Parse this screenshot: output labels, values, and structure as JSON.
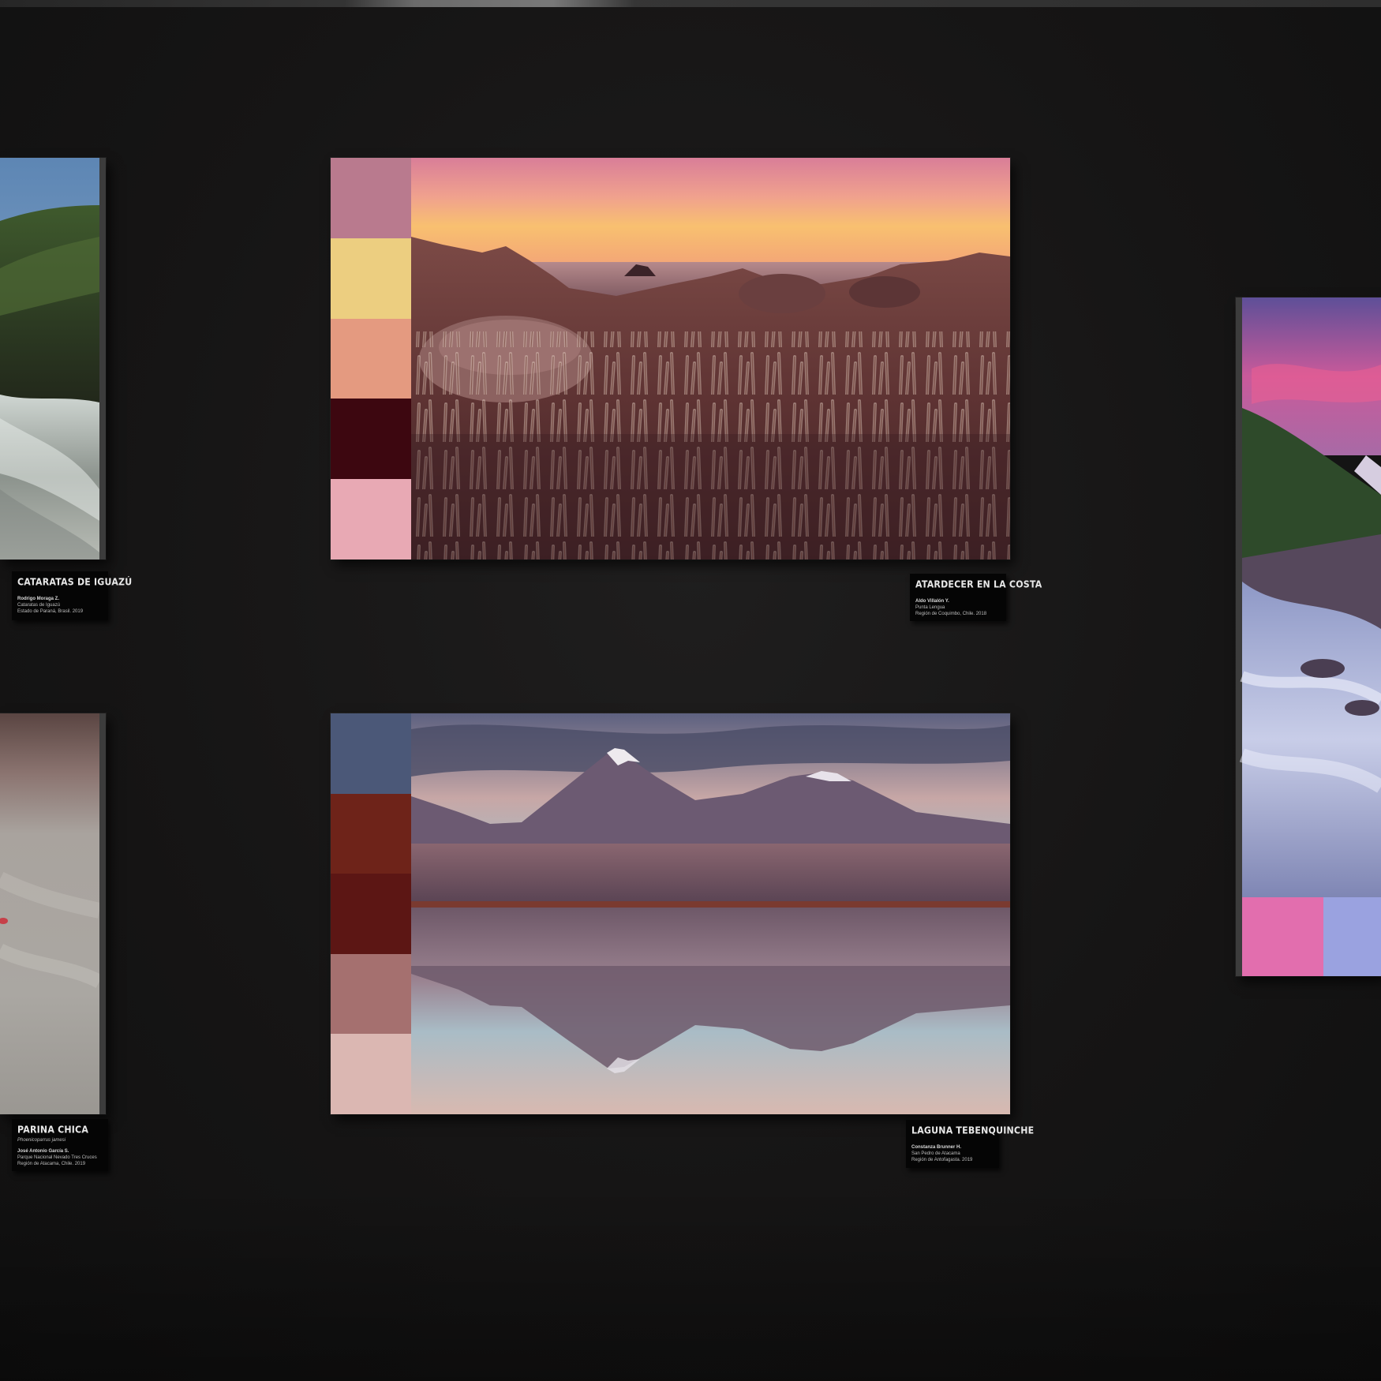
{
  "gallery": {
    "artworks": [
      {
        "id": "cataratas",
        "title": "CATARATAS DE IGUAZÚ",
        "lines": [
          "Rodrigo Moraga Z.",
          "Cataratas de Iguazú",
          "Estado de Paraná, Brasil. 2019"
        ]
      },
      {
        "id": "atardecer",
        "title": "ATARDECER EN LA COSTA",
        "lines": [
          "Aldo Villalón Y.",
          "Punta Lengua",
          "Región de Coquimbo, Chile. 2018"
        ],
        "palette": [
          "#b97a8e",
          "#ecce80",
          "#e49a80",
          "#3d0710",
          "#e8a9b4"
        ]
      },
      {
        "id": "parina",
        "title": "PARINA CHICA",
        "lines": [
          "Phoenicoparrus jamesi",
          "José Antonio García S.",
          "Parque Nacional Nevado Tres Cruces",
          "Región de Atacama, Chile. 2019"
        ]
      },
      {
        "id": "laguna",
        "title": "LAGUNA TEBENQUINCHE",
        "lines": [
          "Constanza Brunner H.",
          "San Pedro de Atacama",
          "Región de Antofagasta. 2019"
        ],
        "palette": [
          "#4b5878",
          "#6e2319",
          "#5c1614",
          "#a5706f",
          "#dbb7b2"
        ]
      },
      {
        "id": "rio",
        "palette": [
          "#e26eae",
          "#9aa2e0"
        ]
      }
    ]
  }
}
